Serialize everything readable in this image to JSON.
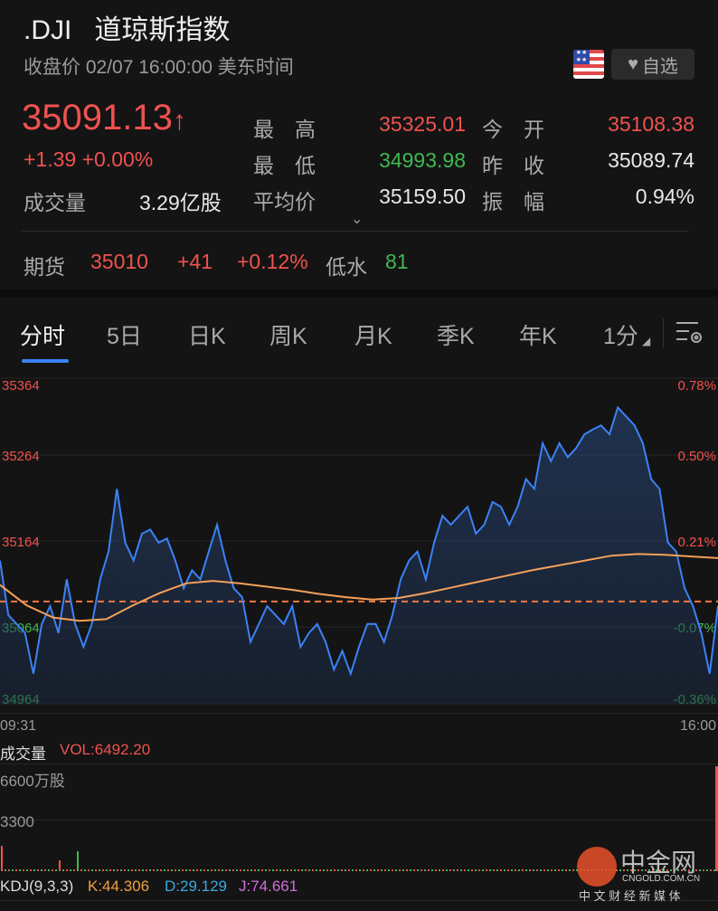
{
  "header": {
    "symbol": ".DJI",
    "name": "道琼斯指数",
    "status": "收盘价 02/07 16:00:00 美东时间",
    "flag": "us-flag-icon",
    "watch_label": "自选"
  },
  "quote": {
    "price": "35091.13",
    "change": "+1.39",
    "change_pct": "+0.00%",
    "stats": [
      {
        "label": "最　高",
        "value": "35325.01",
        "color": "red"
      },
      {
        "label": "今　开",
        "value": "35108.38",
        "color": "red"
      },
      {
        "label": "最　低",
        "value": "34993.98",
        "color": "green"
      },
      {
        "label": "昨　收",
        "value": "35089.74",
        "color": "white"
      },
      {
        "label": "平均价",
        "value": "35159.50",
        "color": "white"
      },
      {
        "label": "振　幅",
        "value": "0.94%",
        "color": "white"
      }
    ],
    "volume_label": "成交量",
    "volume_value": "3.29亿股"
  },
  "futures": {
    "label": "期货",
    "price": "35010",
    "change": "+41",
    "change_pct": "+0.12%",
    "basis_label": "低水",
    "basis": "81"
  },
  "tabs": [
    "分时",
    "5日",
    "日K",
    "周K",
    "月K",
    "季K",
    "年K",
    "1分"
  ],
  "chart_data": {
    "type": "line",
    "prev_close": 35089.74,
    "ylim": [
      34964,
      35364
    ],
    "y_ticks": [
      "35364",
      "35264",
      "35164",
      "35064",
      "34964"
    ],
    "pct_ticks": [
      "0.78%",
      "0.50%",
      "0.21%",
      "-0.07%",
      "-0.36%"
    ],
    "x_labels": [
      "09:31",
      "16:00"
    ],
    "series": [
      {
        "name": "price",
        "values": [
          35140,
          35073,
          35062,
          35051,
          35001,
          35062,
          35084,
          35051,
          35117,
          35062,
          35034,
          35062,
          35117,
          35151,
          35228,
          35162,
          35140,
          35173,
          35178,
          35162,
          35167,
          35140,
          35106,
          35128,
          35117,
          35151,
          35184,
          35140,
          35106,
          35095,
          35040,
          35062,
          35084,
          35073,
          35062,
          35084,
          35034,
          35051,
          35062,
          35040,
          35006,
          35029,
          35001,
          35034,
          35062,
          35062,
          35040,
          35073,
          35117,
          35140,
          35151,
          35117,
          35162,
          35195,
          35184,
          35195,
          35206,
          35173,
          35184,
          35212,
          35206,
          35184,
          35206,
          35240,
          35228,
          35284,
          35262,
          35284,
          35267,
          35278,
          35295,
          35301,
          35306,
          35295,
          35328,
          35317,
          35306,
          35284,
          35240,
          35228,
          35162,
          35151,
          35106,
          35084,
          35051,
          35001,
          35084
        ]
      },
      {
        "name": "average",
        "values": [
          35110,
          35085,
          35070,
          35066,
          35068,
          35085,
          35100,
          35112,
          35115,
          35112,
          35108,
          35104,
          35099,
          35095,
          35092,
          35094,
          35100,
          35107,
          35114,
          35121,
          35128,
          35134,
          35140,
          35146,
          35148,
          35147,
          35145,
          35143
        ]
      }
    ],
    "colors": {
      "price": "#3b82f6",
      "average": "#f5a05a",
      "prev_close": "#f07840"
    }
  },
  "volume": {
    "label": "成交量",
    "vol": "VOL:6492.20",
    "ticks": [
      "6600万股",
      "3300"
    ]
  },
  "kdj": {
    "label": "KDJ(9,3,3)",
    "k": "K:44.306",
    "d": "D:29.129",
    "j": "J:74.661"
  },
  "watermark": {
    "brand": "中金网",
    "domain": "CNGOLD.COM.CN",
    "slogan": "中 文 财 经 新 媒 体"
  }
}
